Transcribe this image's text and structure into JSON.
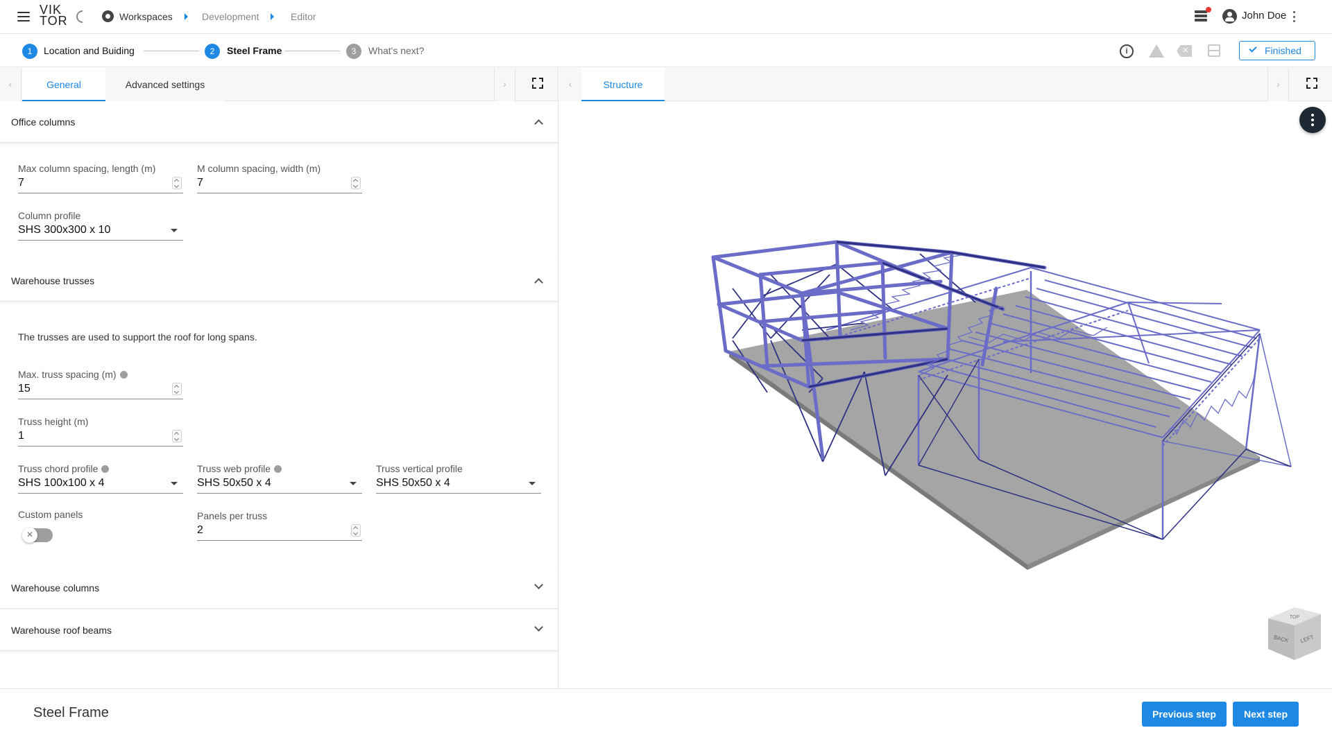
{
  "topbar": {
    "logo_line1": "VIK",
    "logo_line2": "TOR",
    "breadcrumb": [
      "Workspaces",
      "Development",
      "Editor"
    ],
    "user_name": "John Doe"
  },
  "steps": [
    {
      "number": "1",
      "label": "Location and Buiding",
      "state": "done"
    },
    {
      "number": "2",
      "label": "Steel Frame",
      "state": "active"
    },
    {
      "number": "3",
      "label": "What's next?",
      "state": "pending"
    }
  ],
  "status_button": "Finished",
  "colors": {
    "accent": "#1e88e5",
    "frame": "#6a6cc8",
    "frame_dark": "#2e3182",
    "ground": "#9a9a9a"
  },
  "left_tabs": [
    "General",
    "Advanced settings"
  ],
  "sections": {
    "office_columns": {
      "title": "Office columns",
      "max_col_length_label": "Max column spacing, length (m)",
      "max_col_length_value": "7",
      "col_width_label": "M column spacing, width (m)",
      "col_width_value": "7",
      "col_profile_label": "Column profile",
      "col_profile_value": "SHS 300x300 x 10"
    },
    "warehouse_trusses": {
      "title": "Warehouse trusses",
      "description": "The trusses are used to support the roof for long spans.",
      "truss_spacing_label": "Max. truss spacing (m)",
      "truss_spacing_value": "15",
      "truss_height_label": "Truss height (m)",
      "truss_height_value": "1",
      "chord_label": "Truss chord profile",
      "chord_value": "SHS 100x100 x 4",
      "web_label": "Truss web profile",
      "web_value": "SHS 50x50 x 4",
      "vertical_label": "Truss vertical profile",
      "vertical_value": "SHS 50x50 x 4",
      "custom_panels_label": "Custom panels",
      "custom_panels_on": false,
      "panels_label": "Panels per truss",
      "panels_value": "2"
    },
    "warehouse_columns": {
      "title": "Warehouse columns"
    },
    "warehouse_roof_beams": {
      "title": "Warehouse roof beams"
    }
  },
  "right_tabs": [
    "Structure"
  ],
  "viewcube": {
    "top": "TOP",
    "front": "BACK",
    "side": "LEFT"
  },
  "footer": {
    "title": "Steel Frame",
    "prev": "Previous step",
    "next": "Next step"
  }
}
